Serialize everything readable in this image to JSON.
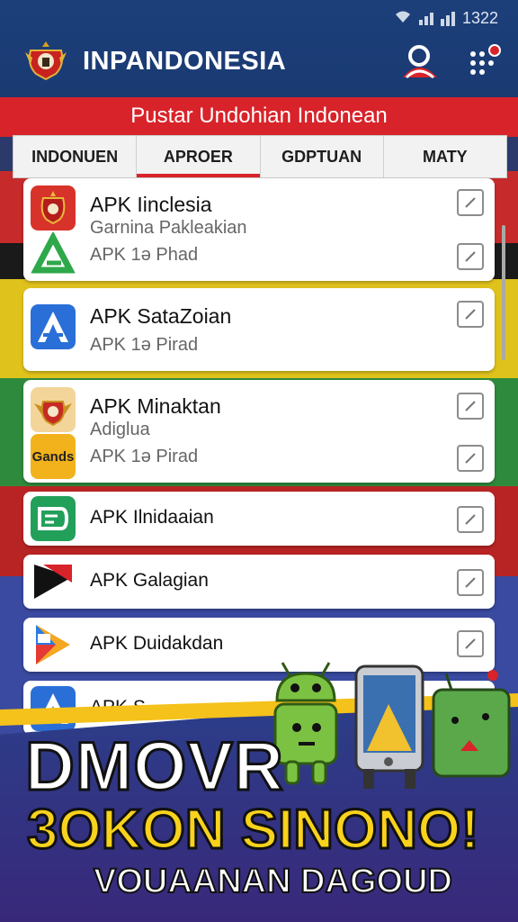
{
  "status_bar": {
    "time": "1322"
  },
  "header": {
    "title": "INPANDONESIA"
  },
  "banner": {
    "subtitle": "Pustar Undohian Indonean"
  },
  "tabs": [
    {
      "label": "INDONUEN",
      "active": false
    },
    {
      "label": "APROER",
      "active": true
    },
    {
      "label": "GDPTUAN",
      "active": false
    },
    {
      "label": "MATY",
      "active": false
    }
  ],
  "list": [
    {
      "title": "APK Iinclesia",
      "subtitle": "Garnina Pakleakian",
      "meta": "APK 1ə  Phad"
    },
    {
      "title": "APK SataZoian",
      "meta": "APK 1ə  Pirad"
    },
    {
      "title": "APK Minaktan",
      "subtitle": "Adiglua",
      "meta": "APK 1ə  Pirad",
      "icon_text": "Gands"
    },
    {
      "title": "APK Ilnidaaian"
    },
    {
      "title": "APK Galagian"
    },
    {
      "title": "APK Duidakdan"
    },
    {
      "title": "APK S..."
    }
  ],
  "promo": {
    "headline": "DMOVR",
    "highlight": "3OKON SINONO!",
    "tagline": "VOUAANAN DAGOUD"
  },
  "colors": {
    "brand_red": "#d8232a",
    "header_blue": "#1c3f7a",
    "promo_yellow": "#f8d21c"
  }
}
